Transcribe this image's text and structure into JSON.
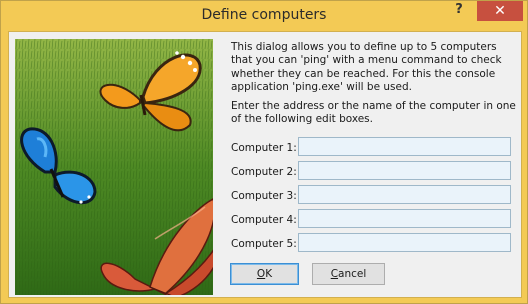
{
  "window": {
    "title": "Define computers",
    "help_glyph": "?",
    "close_glyph": "✕",
    "accent_color": "#f3ca55"
  },
  "dialog": {
    "description": "This dialog allows you to define up to 5 computers that you can 'ping' with a menu command to check whether they can be reached. For this the console application 'ping.exe' will be used.",
    "instruction": "Enter the address or the name of the computer in one of the following edit boxes.",
    "fields": [
      {
        "label": "Computer 1:",
        "value": ""
      },
      {
        "label": "Computer 2:",
        "value": ""
      },
      {
        "label": "Computer 3:",
        "value": ""
      },
      {
        "label": "Computer 4:",
        "value": ""
      },
      {
        "label": "Computer 5:",
        "value": ""
      }
    ],
    "ok_accel": "O",
    "ok_rest": "K",
    "cancel_accel": "C",
    "cancel_rest": "ancel"
  },
  "image": {
    "icon": "butterflies-on-grass-image"
  }
}
